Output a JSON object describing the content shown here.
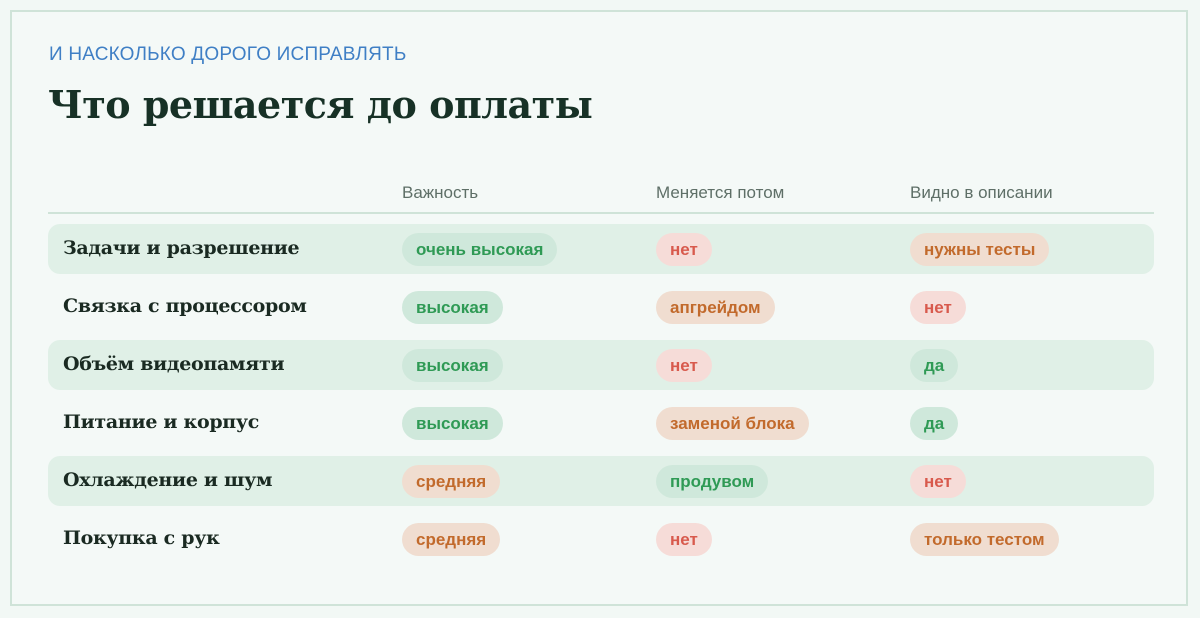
{
  "header": {
    "kicker": "И НАСКОЛЬКО ДОРОГО ИСПРАВЛЯТЬ",
    "title": "Что решается до оплаты"
  },
  "table": {
    "columns": [
      "Важность",
      "Меняется потом",
      "Видно в описании"
    ],
    "rows": [
      {
        "label": "Задачи и разрешение",
        "importance": "очень высокая",
        "changes_later": "нет",
        "in_description": "нужны тесты"
      },
      {
        "label": "Связка с процессором",
        "importance": "высокая",
        "changes_later": "апгрейдом",
        "in_description": "нет"
      },
      {
        "label": "Объём видеопамяти",
        "importance": "высокая",
        "changes_later": "нет",
        "in_description": "да"
      },
      {
        "label": "Питание и корпус",
        "importance": "высокая",
        "changes_later": "заменой блока",
        "in_description": "да"
      },
      {
        "label": "Охлаждение и шум",
        "importance": "средняя",
        "changes_later": "продувом",
        "in_description": "нет"
      },
      {
        "label": "Покупка с рук",
        "importance": "средняя",
        "changes_later": "нет",
        "in_description": "только тестом"
      }
    ]
  },
  "colors": {
    "accent": "#3f7fc5",
    "title": "#173126",
    "row_shade": "#e0f0e7",
    "pill_green_bg": "#cfe8db",
    "pill_green_text": "#2f9a55",
    "pill_orange_bg": "#f0ddd0",
    "pill_orange_text": "#c26a2c",
    "pill_red_bg": "#f6dcd8",
    "pill_red_text": "#d85a4d"
  }
}
